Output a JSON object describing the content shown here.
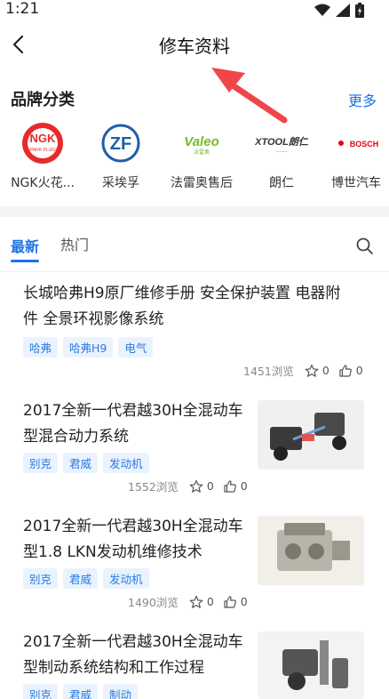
{
  "status": {
    "time": "1:21"
  },
  "header": {
    "title": "修车资料"
  },
  "brands": {
    "heading": "品牌分类",
    "more": "更多",
    "items": [
      {
        "name": "NGK火花...",
        "logo_text": "NGK"
      },
      {
        "name": "采埃孚",
        "logo_text": "ZF"
      },
      {
        "name": "法雷奥售后",
        "logo_text": "Valeo"
      },
      {
        "name": "朗仁",
        "logo_text": "XTOOL朗仁"
      },
      {
        "name": "博世汽车",
        "logo_text": "BOSCH"
      }
    ]
  },
  "tabs": {
    "latest": "最新",
    "hot": "热门"
  },
  "articles": [
    {
      "title_line1": "长城哈弗H9原厂维修手册 安全保护装置 电器附",
      "title_line2": "件 全景环视影像系统",
      "tags": [
        "哈弗",
        "哈弗H9",
        "电气"
      ],
      "views": "1451浏览",
      "stars": "0",
      "likes": "0"
    },
    {
      "title_line1": "2017全新一代君越30H全混动车",
      "title_line2": "型混合动力系统",
      "tags": [
        "别克",
        "君威",
        "发动机"
      ],
      "views": "1552浏览",
      "stars": "0",
      "likes": "0"
    },
    {
      "title_line1": "2017全新一代君越30H全混动车",
      "title_line2": "型1.8 LKN发动机维修技术",
      "tags": [
        "别克",
        "君威",
        "发动机"
      ],
      "views": "1490浏览",
      "stars": "0",
      "likes": "0"
    },
    {
      "title_line1": "2017全新一代君越30H全混动车",
      "title_line2": "型制动系统结构和工作过程",
      "tags": [
        "别克",
        "君威",
        "制动"
      ],
      "views": "",
      "stars": "",
      "likes": ""
    }
  ],
  "colors": {
    "accent": "#1a73e8",
    "annotation_arrow": "#f0464b"
  }
}
